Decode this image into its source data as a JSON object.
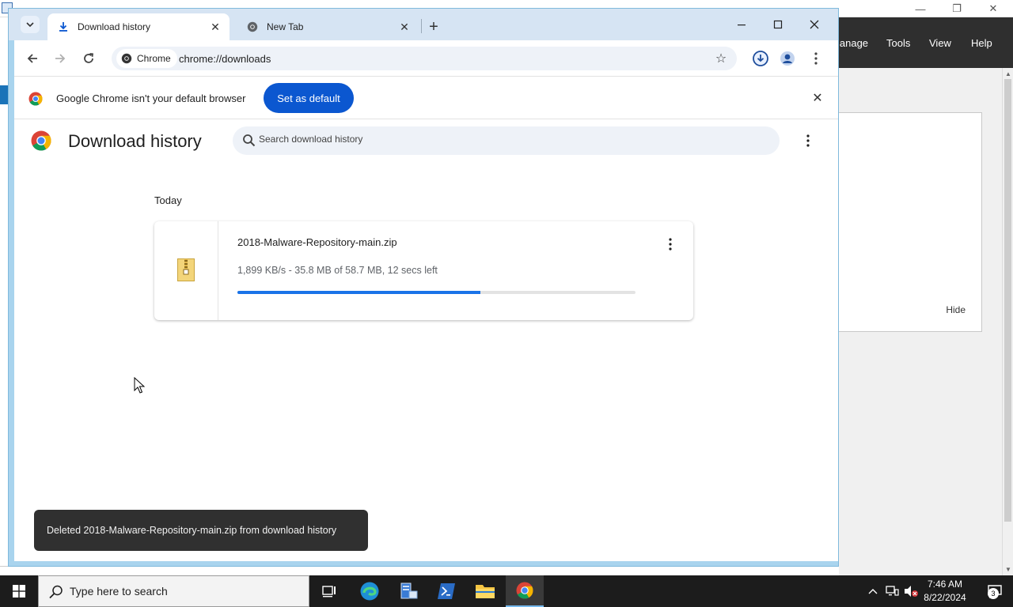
{
  "background_app": {
    "menu_items": [
      "lanage",
      "Tools",
      "View",
      "Help"
    ],
    "hide_label": "Hide"
  },
  "tabs": [
    {
      "title": "Download history",
      "active": true,
      "icon": "download-icon"
    },
    {
      "title": "New Tab",
      "active": false,
      "icon": "chrome-icon"
    }
  ],
  "toolbar": {
    "chip_label": "Chrome",
    "url": "chrome://downloads"
  },
  "infobar": {
    "message": "Google Chrome isn't your default browser",
    "button_label": "Set as default"
  },
  "page": {
    "title": "Download history",
    "search_placeholder": "Search download history",
    "date_group": "Today"
  },
  "download": {
    "file_name": "2018-Malware-Repository-main.zip",
    "status": "1,899 KB/s - 35.8 MB of 58.7 MB, 12 secs left",
    "progress_fraction": 0.61
  },
  "toast": {
    "message": "Deleted 2018-Malware-Repository-main.zip from download history"
  },
  "taskbar": {
    "search_placeholder": "Type here to search",
    "time": "7:46 AM",
    "date": "8/22/2024",
    "notification_count": "3"
  },
  "colors": {
    "accent": "#0b57d0",
    "progress": "#1a73e8",
    "toast_bg": "#303030"
  }
}
